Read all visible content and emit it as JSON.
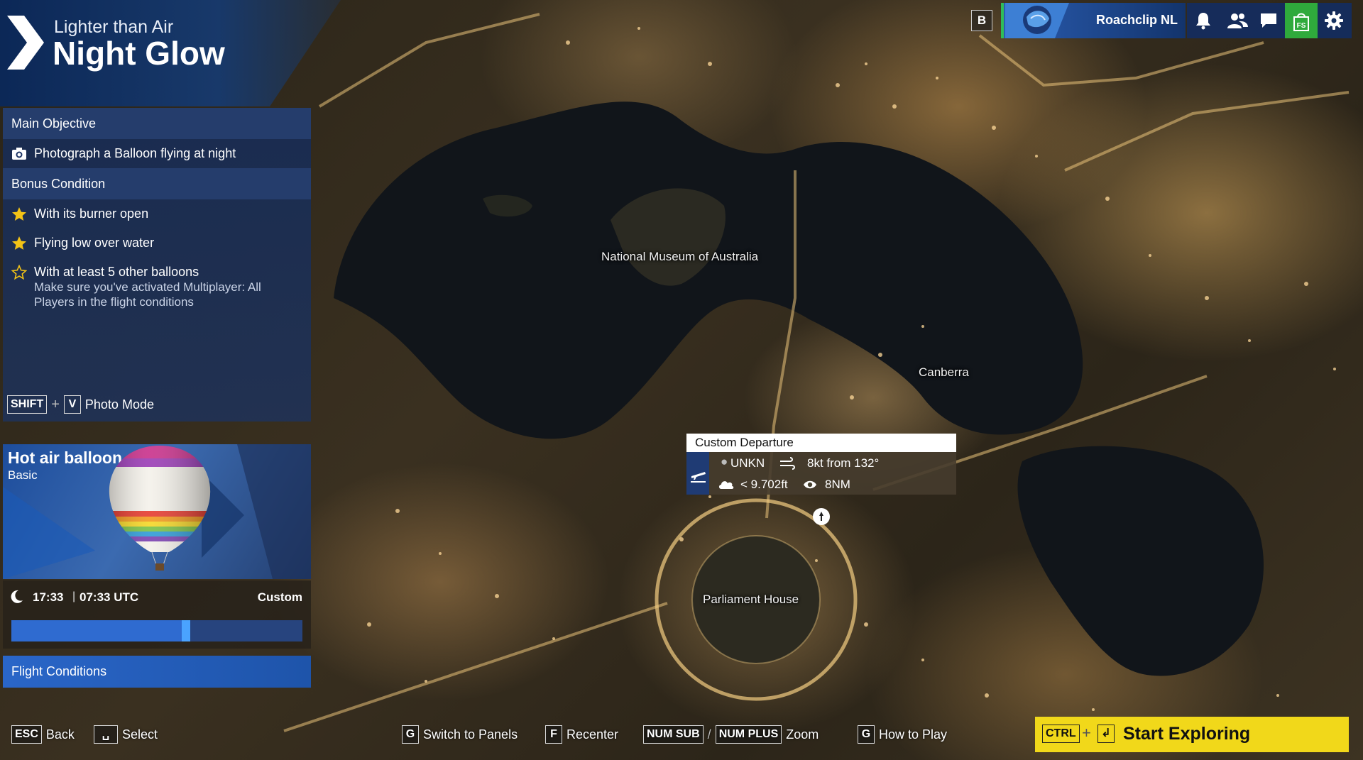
{
  "mission": {
    "subtitle": "Lighter than Air",
    "title": "Night Glow"
  },
  "objectives": {
    "main_header": "Main Objective",
    "main_items": [
      {
        "icon": "camera-icon",
        "text": "Photograph a Balloon flying at night"
      }
    ],
    "bonus_header": "Bonus Condition",
    "bonus_items": [
      {
        "icon": "star-filled-icon",
        "text": "With its burner open"
      },
      {
        "icon": "star-filled-icon",
        "text": "Flying low over water"
      },
      {
        "icon": "star-outline-icon",
        "text": "With at least 5 other balloons",
        "note": "Make sure you've activated Multiplayer: All Players in the flight conditions"
      }
    ],
    "photo_hint": {
      "key1": "SHIFT",
      "key2": "V",
      "label": "Photo Mode"
    }
  },
  "aircraft": {
    "name": "Hot air balloon",
    "variant": "Basic"
  },
  "time": {
    "local": "17:33",
    "separator": "|",
    "utc": "07:33 UTC",
    "mode": "Custom",
    "slider_fraction": 0.6
  },
  "flight_conditions": "Flight Conditions",
  "profile": {
    "key": "B",
    "name": "Roachclip NL"
  },
  "top_icons": [
    "bell-icon",
    "friends-icon",
    "chat-icon",
    "store-icon",
    "gear-icon"
  ],
  "map": {
    "labels": {
      "museum": "National Museum of Australia",
      "canberra": "Canberra",
      "parliament": "Parliament House"
    }
  },
  "departure": {
    "title": "Custom Departure",
    "airport": "UNKN",
    "wind": "8kt from 132°",
    "clouds": "< 9.702ft",
    "visibility": "8NM"
  },
  "bottom_hints": {
    "back": {
      "key": "ESC",
      "label": "Back"
    },
    "select": {
      "key": "␣",
      "label": "Select"
    },
    "panels": {
      "key": "G",
      "label": "Switch to Panels"
    },
    "recenter": {
      "key": "F",
      "label": "Recenter"
    },
    "num_sub": {
      "key": "NUM SUB"
    },
    "slash": "/",
    "num_plus": {
      "key": "NUM PLUS",
      "label": "Zoom"
    },
    "how_to_play": {
      "key": "G",
      "label": "How to Play"
    }
  },
  "start": {
    "key": "CTRL",
    "key2": "↲",
    "label": "Start Exploring"
  },
  "colors": {
    "accent_blue": "#2a66c8",
    "start_yellow": "#f1d81a",
    "online_green": "#2fbd59"
  }
}
